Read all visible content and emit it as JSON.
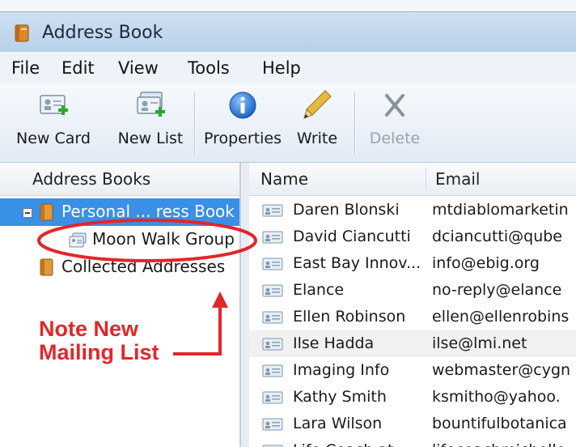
{
  "window": {
    "title": "Address Book",
    "icon": "address-book-icon"
  },
  "menubar": [
    "File",
    "Edit",
    "View",
    "Tools",
    "Help"
  ],
  "toolbar": {
    "new_card": "New Card",
    "new_list": "New List",
    "properties": "Properties",
    "write": "Write",
    "delete": "Delete"
  },
  "left_pane": {
    "header": "Address Books",
    "items": [
      {
        "label": "Personal ... ress Book",
        "icon": "address-book-icon",
        "selected": true
      },
      {
        "label": "Moon Walk Group",
        "icon": "mailing-list-icon"
      },
      {
        "label": "Collected Addresses",
        "icon": "address-book-icon"
      }
    ]
  },
  "contacts": {
    "columns": {
      "name": "Name",
      "email": "Email"
    },
    "rows": [
      {
        "name": "Daren Blonski",
        "email": "mtdiablomarketin"
      },
      {
        "name": "David Ciancutti",
        "email": "dciancutti@qube"
      },
      {
        "name": "East Bay Innov...",
        "email": "info@ebig.org"
      },
      {
        "name": "Elance",
        "email": "no-reply@elance"
      },
      {
        "name": "Ellen Robinson",
        "email": "ellen@ellenrobins"
      },
      {
        "name": "Ilse Hadda",
        "email": "ilse@lmi.net"
      },
      {
        "name": "Imaging Info",
        "email": "webmaster@cygn"
      },
      {
        "name": "Kathy Smith",
        "email": "ksmitho@yahoo."
      },
      {
        "name": "Lara Wilson",
        "email": "bountifulbotanica"
      },
      {
        "name": "Life Coach at...",
        "email": "lifecoachmichelle"
      }
    ]
  },
  "annotation": {
    "line1": "Note New",
    "line2": "Mailing List",
    "color": "#e3262a"
  },
  "colors": {
    "selection": "#3a8fe6",
    "accent": "#e3262a"
  }
}
